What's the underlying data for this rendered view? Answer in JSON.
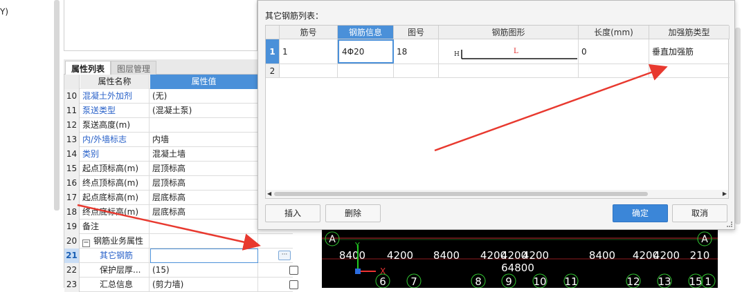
{
  "left_fragment": "Y)",
  "tabs": {
    "attr": "属性列表",
    "layer": "图层管理"
  },
  "prop_header": {
    "name": "属性名称",
    "value": "属性值"
  },
  "props": [
    {
      "n": "10",
      "name": "混凝土外加剂",
      "value": "(无)",
      "blue": true
    },
    {
      "n": "11",
      "name": "泵送类型",
      "value": "(混凝土泵)",
      "blue": true
    },
    {
      "n": "12",
      "name": "泵送高度(m)",
      "value": "",
      "blue": false
    },
    {
      "n": "13",
      "name": "内/外墙标志",
      "value": "内墙",
      "blue": true
    },
    {
      "n": "14",
      "name": "类别",
      "value": "混凝土墙",
      "blue": true
    },
    {
      "n": "15",
      "name": "起点顶标高(m)",
      "value": "层顶标高",
      "blue": false
    },
    {
      "n": "16",
      "name": "终点顶标高(m)",
      "value": "层顶标高",
      "blue": false
    },
    {
      "n": "17",
      "name": "起点底标高(m)",
      "value": "层底标高",
      "blue": false
    },
    {
      "n": "18",
      "name": "终点底标高(m)",
      "value": "层底标高",
      "blue": false
    },
    {
      "n": "19",
      "name": "备注",
      "value": "",
      "blue": false
    },
    {
      "n": "20",
      "name": "钢筋业务属性",
      "value": "",
      "blue": false
    },
    {
      "n": "21",
      "name": "其它钢筋",
      "value": "",
      "blue": true
    },
    {
      "n": "22",
      "name": "保护层厚...",
      "value": "(15)",
      "blue": false
    },
    {
      "n": "23",
      "name": "汇总信息",
      "value": "(剪力墙)",
      "blue": false
    }
  ],
  "ellipsis": "···",
  "dialog": {
    "title": "其它钢筋列表：",
    "headers": [
      "筋号",
      "钢筋信息",
      "图号",
      "钢筋图形",
      "长度(mm)",
      "加强筋类型"
    ],
    "rows": [
      {
        "n": "1",
        "num": "1",
        "info": "4Φ20",
        "fig": "18",
        "shape_h": "H",
        "shape_l": "L",
        "len": "0",
        "type": "垂直加强筋"
      },
      {
        "n": "2",
        "num": "",
        "info": "",
        "fig": "",
        "shape_h": "",
        "shape_l": "",
        "len": "",
        "type": ""
      }
    ],
    "buttons": {
      "insert": "插入",
      "delete": "删除",
      "ok": "确定",
      "cancel": "取消"
    }
  },
  "cad": {
    "axis_top_left": "A",
    "axis_top_right": "A",
    "dims": [
      "8400",
      "4200",
      "8400",
      "4200",
      "4200",
      "4200",
      "8400",
      "4200",
      "4200",
      "210"
    ],
    "total": "64800",
    "axis_y": "Y",
    "axis_x": "X",
    "grid_numbers": [
      "6",
      "7",
      "8",
      "9",
      "10",
      "11",
      "12",
      "13",
      "15",
      "1"
    ]
  },
  "colors": {
    "accent": "#3b86d8",
    "header_blue": "#4a90d9",
    "arrow": "#e8392f"
  }
}
